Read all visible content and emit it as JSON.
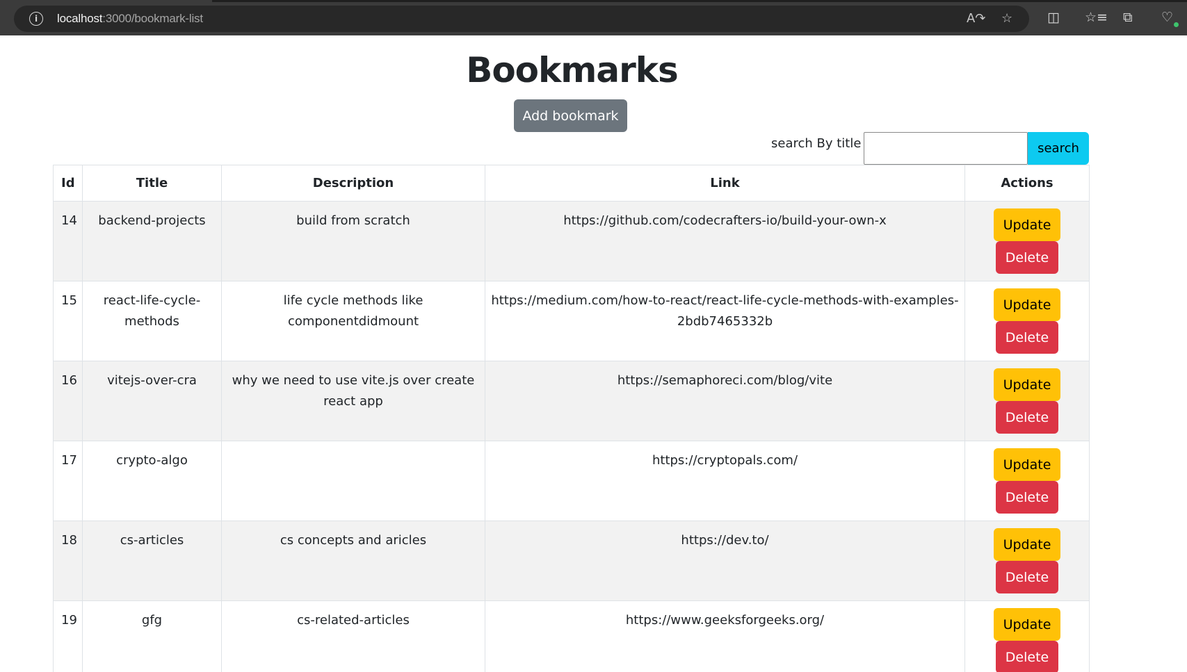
{
  "browser": {
    "url_host": "localhost",
    "url_path": ":3000/bookmark-list",
    "icons": [
      "info-icon",
      "read-aloud-icon",
      "favorite-star-icon",
      "split-screen-icon",
      "favorites-icon",
      "collections-icon",
      "browser-essentials-icon"
    ]
  },
  "page": {
    "title": "Bookmarks",
    "add_button": "Add bookmark",
    "search_label": "search By title :",
    "search_value": "",
    "search_button": "search"
  },
  "table": {
    "headers": {
      "id": "Id",
      "title": "Title",
      "description": "Description",
      "link": "Link",
      "actions": "Actions"
    },
    "update_label": "Update",
    "delete_label": "Delete",
    "rows": [
      {
        "id": "14",
        "title": "backend-projects",
        "description": "build from scratch",
        "link": "https://github.com/codecrafters-io/build-your-own-x"
      },
      {
        "id": "15",
        "title": "react-life-cycle-methods",
        "description": "life cycle methods like componentdidmount",
        "link": "https://medium.com/how-to-react/react-life-cycle-methods-with-examples-2bdb7465332b"
      },
      {
        "id": "16",
        "title": "vitejs-over-cra",
        "description": "why we need to use vite.js over create react app",
        "link": "https://semaphoreci.com/blog/vite"
      },
      {
        "id": "17",
        "title": "crypto-algo",
        "description": "",
        "link": "https://cryptopals.com/"
      },
      {
        "id": "18",
        "title": "cs-articles",
        "description": "cs concepts and aricles",
        "link": "https://dev.to/"
      },
      {
        "id": "19",
        "title": "gfg",
        "description": "cs-related-articles",
        "link": "https://www.geeksforgeeks.org/"
      }
    ]
  }
}
